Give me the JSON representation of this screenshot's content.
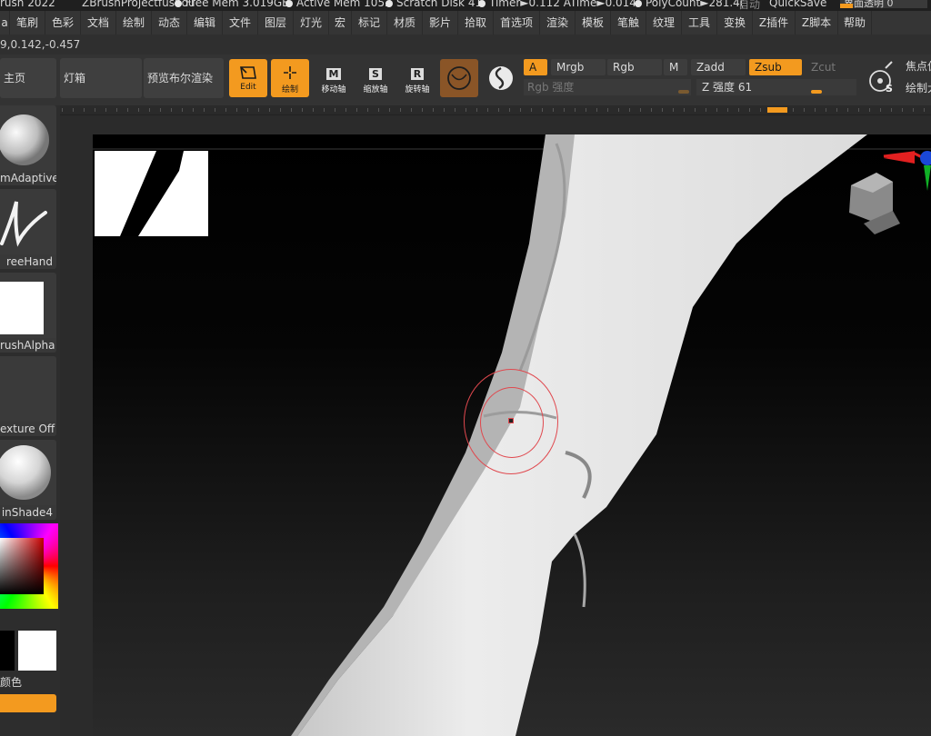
{
  "titlebar": {
    "app": "rush 2022",
    "project": "ZBrushProjectfushou",
    "free_mem": "Free Mem 3.019GB",
    "active_mem": "Active Mem 1052",
    "scratch": "Scratch Disk 41",
    "timer": "Timer►0.112 ATime►0.014",
    "polycount": "PolyCount►281.4(",
    "auto": "自动",
    "quicksave": "QuickSave",
    "ui_transparency": "界面透明 0"
  },
  "menu": [
    "a",
    "笔刷",
    "色彩",
    "文档",
    "绘制",
    "动态",
    "编辑",
    "文件",
    "图层",
    "灯光",
    "宏",
    "标记",
    "材质",
    "影片",
    "拾取",
    "首选项",
    "渲染",
    "模板",
    "笔触",
    "纹理",
    "工具",
    "变换",
    "Z插件",
    "Z脚本",
    "帮助"
  ],
  "coordinate_readout": "9,0.142,-0.457",
  "shelf": {
    "home": "主页",
    "lightbox": "灯箱",
    "bpr": "预览布尔渲染",
    "edit": "Edit",
    "draw": "绘制",
    "move": "移动轴",
    "scale": "缩放轴",
    "rotate": "旋转轴",
    "move_key": "M",
    "scale_key": "S",
    "rotate_key": "R",
    "a": "A",
    "mrgb": "Mrgb",
    "rgb": "Rgb",
    "m": "M",
    "zadd": "Zadd",
    "zsub": "Zsub",
    "zcut": "Zcut",
    "rgb_intensity": "Rgb 强度",
    "z_intensity": "Z 强度 61",
    "focal_shift": "焦点偏",
    "draw_size": "绘制大",
    "spotlight_key": "S"
  },
  "tray": {
    "brush": "mAdaptive",
    "stroke": "reeHand",
    "alpha": "rushAlpha",
    "texture": "exture Off",
    "material": "inShade4",
    "color_label": "颜色"
  },
  "colors": {
    "accent": "#f39a1f",
    "cursor_ring": "#e0484e"
  },
  "icons": [
    "edit-icon",
    "draw-icon",
    "move-icon",
    "scale-icon",
    "rotate-icon",
    "sphere-icon",
    "spiral-icon",
    "spotlight-icon",
    "head-navigation-icon"
  ]
}
